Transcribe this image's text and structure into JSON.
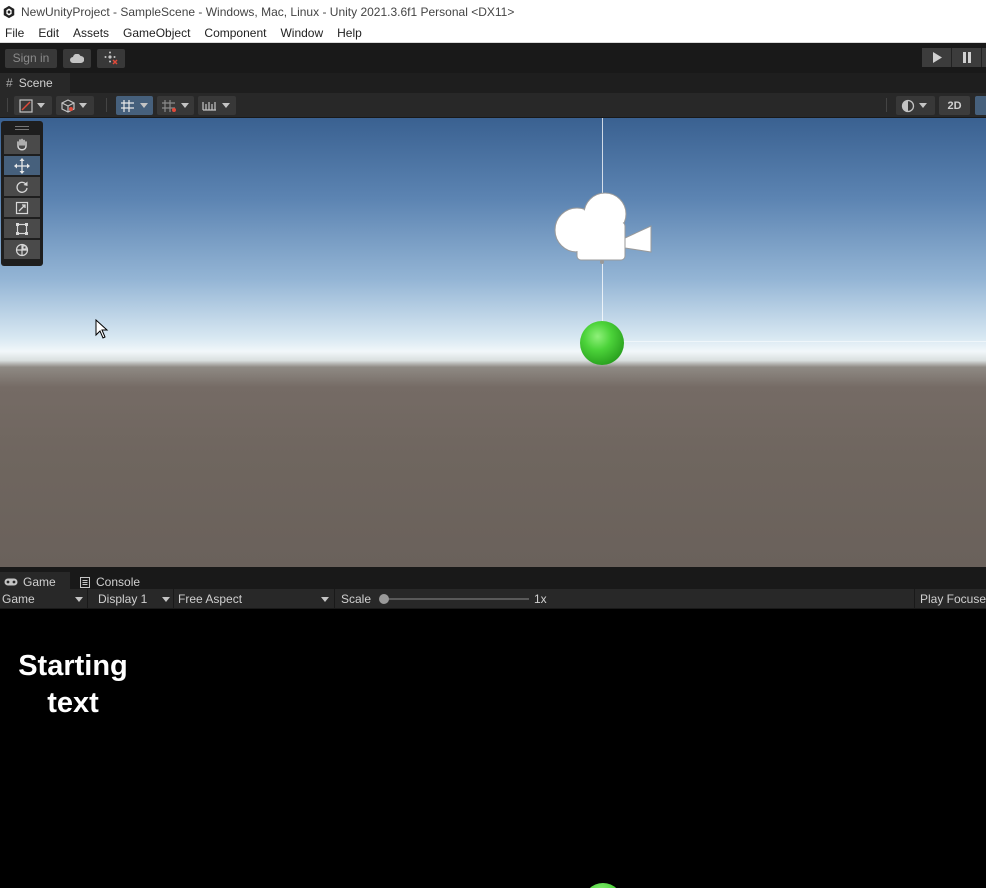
{
  "window": {
    "title": "NewUnityProject - SampleScene - Windows, Mac, Linux - Unity 2021.3.6f1 Personal <DX11>",
    "icon": "unity-logo-icon"
  },
  "menubar": {
    "items": [
      "File",
      "Edit",
      "Assets",
      "GameObject",
      "Component",
      "Window",
      "Help"
    ]
  },
  "toolbar": {
    "signin_label": "Sign in",
    "cloud_icon": "cloud-icon",
    "collab_icon": "collab-icon",
    "play_icon": "play-icon",
    "pause_icon": "pause-icon"
  },
  "scene": {
    "tab_label": "Scene",
    "tab_icon": "hash-icon",
    "toggle_2d_label": "2D",
    "tools": [
      "hand-tool",
      "move-tool",
      "rotate-tool",
      "scale-tool",
      "rect-tool",
      "transform-tool"
    ],
    "active_tool": "move-tool"
  },
  "game": {
    "tabs": [
      {
        "label": "Game",
        "icon": "gamepad-icon"
      },
      {
        "label": "Console",
        "icon": "console-icon"
      }
    ],
    "view_select": "Game",
    "display_select": "Display 1",
    "aspect_select": "Free Aspect",
    "scale_label": "Scale",
    "scale_value": "1x",
    "scale_level": 1,
    "play_focused_label": "Play Focuse",
    "ui_text": "Starting text"
  },
  "colors": {
    "selection_blue": "#46607c",
    "sphere_green": "#4cd33a",
    "editor_dark": "#282828"
  }
}
